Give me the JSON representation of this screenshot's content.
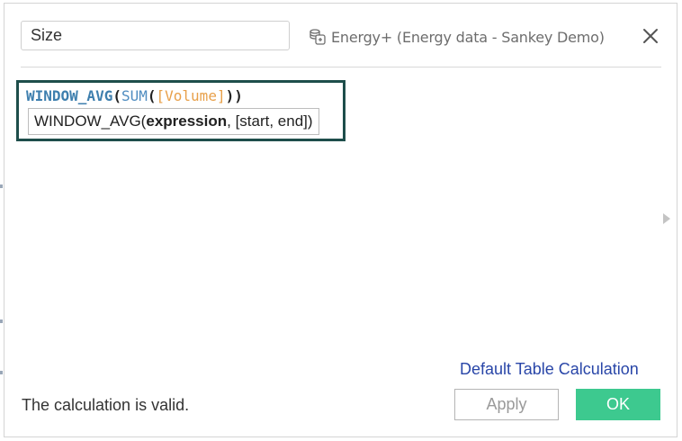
{
  "calc_name": "Size",
  "datasource_label": "Energy+ (Energy data - Sankey Demo)",
  "formula": {
    "fn_outer": "WINDOW_AVG",
    "open1": "(",
    "fn_inner": "SUM",
    "open2": "(",
    "field": "[Volume]",
    "close": "))"
  },
  "tooltip": {
    "fn_name": "WINDOW_AVG(",
    "arg_bold": "expression",
    "rest": ", [start, end])"
  },
  "default_link": "Default Table Calculation",
  "status": "The calculation is valid.",
  "apply_label": "Apply",
  "ok_label": "OK",
  "icons": {
    "datasource": "database-icon",
    "close": "close-icon",
    "expand": "chevron-right-icon"
  },
  "colors": {
    "ok_button": "#3dc98f",
    "formula_border": "#1e4e4b",
    "link": "#2946a8",
    "function": "#3e7fae",
    "field": "#e8a04a"
  }
}
